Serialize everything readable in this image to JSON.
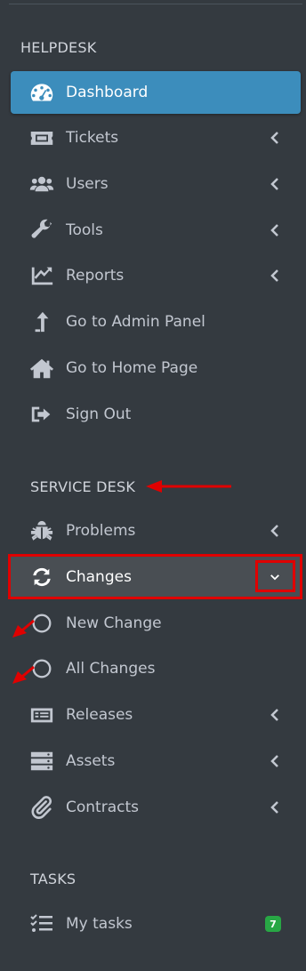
{
  "sections": {
    "helpdesk": "HELPDESK",
    "service_desk": "SERVICE DESK",
    "tasks": "TASKS"
  },
  "helpdesk_items": [
    {
      "label": "Dashboard",
      "icon": "dashboard-icon",
      "active": true
    },
    {
      "label": "Tickets",
      "icon": "ticket-icon"
    },
    {
      "label": "Users",
      "icon": "users-icon"
    },
    {
      "label": "Tools",
      "icon": "wrench-icon"
    },
    {
      "label": "Reports",
      "icon": "chart-icon"
    },
    {
      "label": "Go to Admin Panel",
      "icon": "arrow-up-icon"
    },
    {
      "label": "Go to Home Page",
      "icon": "home-icon"
    },
    {
      "label": "Sign Out",
      "icon": "sign-out-icon"
    }
  ],
  "service_items": [
    {
      "label": "Problems",
      "icon": "bug-icon"
    },
    {
      "label": "Changes",
      "icon": "sync-icon",
      "expanded": true
    },
    {
      "label": "New Change",
      "icon": "circle-icon"
    },
    {
      "label": "All Changes",
      "icon": "circle-icon"
    },
    {
      "label": "Releases",
      "icon": "releases-icon"
    },
    {
      "label": "Assets",
      "icon": "server-icon"
    },
    {
      "label": "Contracts",
      "icon": "paperclip-icon"
    }
  ],
  "task_items": [
    {
      "label": "My tasks",
      "icon": "tasks-icon",
      "badge": "7"
    }
  ],
  "colors": {
    "sidebar_bg": "#343a40",
    "active_bg": "#3c8dbc",
    "open_bg": "#494e53",
    "badge_bg": "#28a745",
    "annotation_red": "#e00000"
  }
}
